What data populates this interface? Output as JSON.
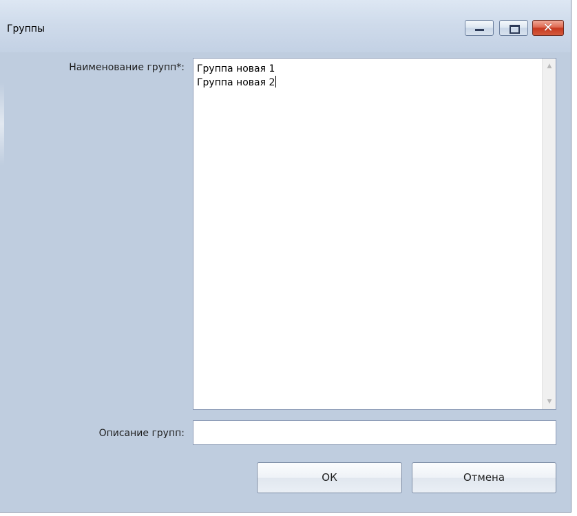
{
  "window": {
    "title": "Группы",
    "minimize_icon": "minimize-icon",
    "maximize_icon": "maximize-icon",
    "close_icon": "close-icon",
    "close_glyph": "✕"
  },
  "form": {
    "names_label": "Наименование групп*:",
    "names_lines": [
      "Группа новая 1",
      "Группа новая 2"
    ],
    "description_label": "Описание групп:",
    "description_value": ""
  },
  "buttons": {
    "ok_label": "ОК",
    "cancel_label": "Отмена"
  },
  "colors": {
    "window_bg": "#bfcddf",
    "close_button": "#d35a3d"
  }
}
